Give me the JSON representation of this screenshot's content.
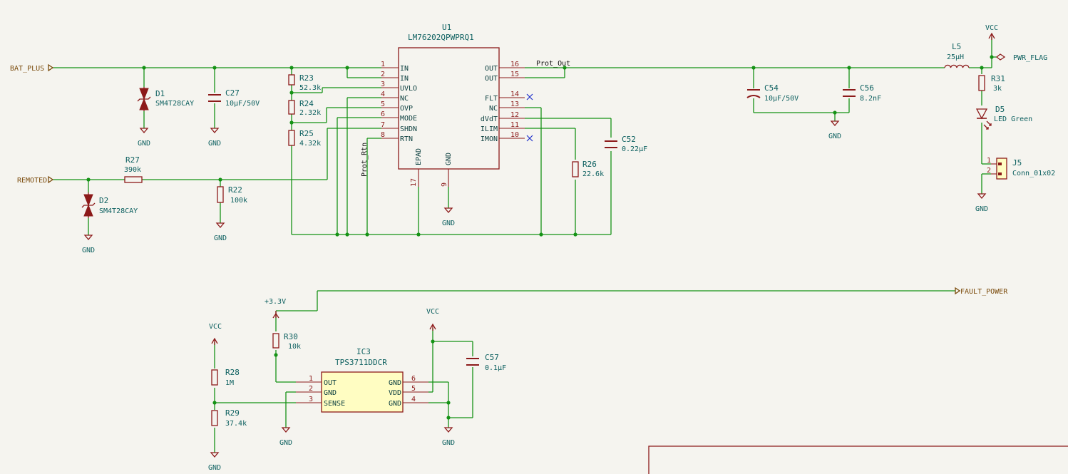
{
  "labels": {
    "bat_plus": "BAT_PLUS",
    "remoted": "REMOTED",
    "fault_power": "FAULT_POWER",
    "prot_out": "Prot_Out",
    "prot_rtn": "Prot_Rtn"
  },
  "power": {
    "gnd": "GND",
    "vcc": "VCC",
    "v33": "+3.3V",
    "pwr_flag": "PWR_FLAG"
  },
  "u1": {
    "ref": "U1",
    "value": "LM76202QPWPRQ1",
    "left_pins": [
      {
        "num": "1",
        "name": "IN"
      },
      {
        "num": "2",
        "name": "IN"
      },
      {
        "num": "3",
        "name": "UVLO"
      },
      {
        "num": "4",
        "name": "NC"
      },
      {
        "num": "5",
        "name": "OVP"
      },
      {
        "num": "6",
        "name": "MODE"
      },
      {
        "num": "7",
        "name": "SHDN"
      },
      {
        "num": "8",
        "name": "RTN"
      }
    ],
    "right_pins": [
      {
        "num": "16",
        "name": "OUT"
      },
      {
        "num": "15",
        "name": "OUT"
      },
      {
        "num": "14",
        "name": "FLT"
      },
      {
        "num": "13",
        "name": "NC"
      },
      {
        "num": "12",
        "name": "dVdT"
      },
      {
        "num": "11",
        "name": "ILIM"
      },
      {
        "num": "10",
        "name": "IMON"
      }
    ],
    "bottom_pins": [
      {
        "num": "17",
        "name": "EPAD"
      },
      {
        "num": "9",
        "name": "GND"
      }
    ]
  },
  "ic3": {
    "ref": "IC3",
    "value": "TPS3711DDCR",
    "left_pins": [
      {
        "num": "1",
        "name": "OUT"
      },
      {
        "num": "2",
        "name": "GND"
      },
      {
        "num": "3",
        "name": "SENSE"
      }
    ],
    "right_pins": [
      {
        "num": "6",
        "name": "GND"
      },
      {
        "num": "5",
        "name": "VDD"
      },
      {
        "num": "4",
        "name": "GND"
      }
    ]
  },
  "components": {
    "d1": {
      "ref": "D1",
      "value": "SM4T28CAY"
    },
    "d2": {
      "ref": "D2",
      "value": "SM4T28CAY"
    },
    "c27": {
      "ref": "C27",
      "value": "10µF/50V"
    },
    "r23": {
      "ref": "R23",
      "value": "52.3k"
    },
    "r24": {
      "ref": "R24",
      "value": "2.32k"
    },
    "r25": {
      "ref": "R25",
      "value": "4.32k"
    },
    "r27": {
      "ref": "R27",
      "value": "390k"
    },
    "r22": {
      "ref": "R22",
      "value": "100k"
    },
    "c52": {
      "ref": "C52",
      "value": "0.22µF"
    },
    "r26": {
      "ref": "R26",
      "value": "22.6k"
    },
    "c54": {
      "ref": "C54",
      "value": "10µF/50V"
    },
    "c56": {
      "ref": "C56",
      "value": "8.2nF"
    },
    "l5": {
      "ref": "L5",
      "value": "25µH"
    },
    "r31": {
      "ref": "R31",
      "value": "3k"
    },
    "d5": {
      "ref": "D5",
      "value": "LED Green"
    },
    "j5": {
      "ref": "J5",
      "value": "Conn_01x02",
      "pins": [
        "1",
        "2"
      ]
    },
    "r30": {
      "ref": "R30",
      "value": "10k"
    },
    "r28": {
      "ref": "R28",
      "value": "1M"
    },
    "r29": {
      "ref": "R29",
      "value": "37.4k"
    },
    "c57": {
      "ref": "C57",
      "value": "0.1µF"
    }
  }
}
